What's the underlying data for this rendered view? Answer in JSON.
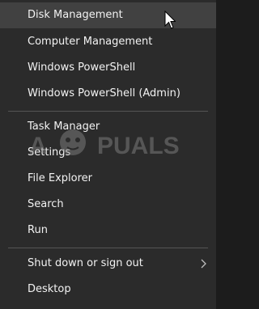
{
  "menu": {
    "items": [
      {
        "label": "Disk Management"
      },
      {
        "label": "Computer Management"
      },
      {
        "label": "Windows PowerShell"
      },
      {
        "label": "Windows PowerShell (Admin)"
      },
      {
        "label": "Task Manager"
      },
      {
        "label": "Settings"
      },
      {
        "label": "File Explorer"
      },
      {
        "label": "Search"
      },
      {
        "label": "Run"
      },
      {
        "label": "Shut down or sign out"
      },
      {
        "label": "Desktop"
      }
    ]
  },
  "watermark": {
    "text": "APPUALS"
  },
  "colors": {
    "background": "#2b2b2b",
    "hover": "#414141",
    "text": "#f2f2f2",
    "separator": "#555555"
  },
  "icons": {
    "submenu": "chevron-right-icon",
    "pointer": "mouse-cursor-icon"
  }
}
